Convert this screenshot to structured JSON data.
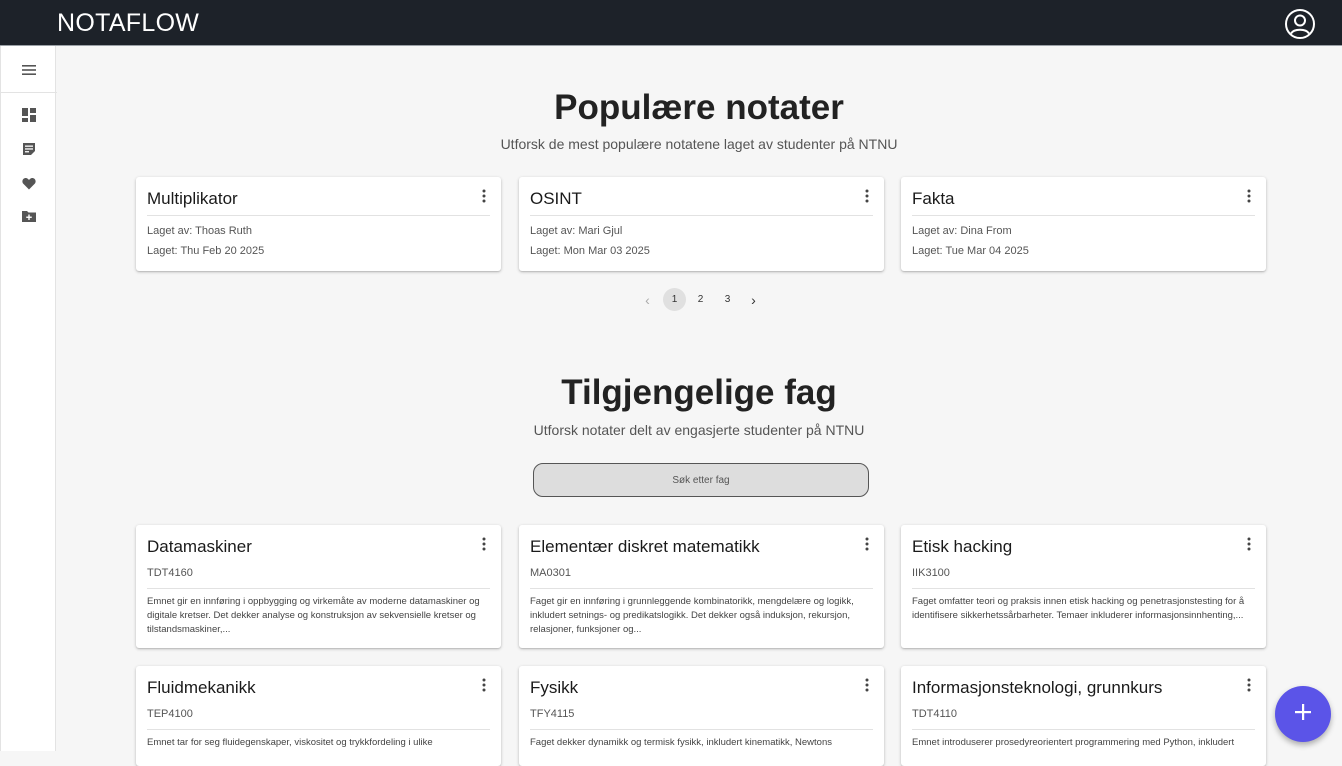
{
  "app": {
    "brand": "NOTAFLOW"
  },
  "sidebar": {
    "items": [
      {
        "icon": "menu-icon"
      },
      {
        "icon": "dashboard-icon"
      },
      {
        "icon": "notes-icon"
      },
      {
        "icon": "heart-icon"
      },
      {
        "icon": "add-folder-icon"
      }
    ]
  },
  "popular": {
    "title": "Populære notater",
    "subtitle": "Utforsk de mest populære notatene laget av studenter på NTNU",
    "cards": [
      {
        "title": "Multiplikator",
        "author": "Laget av: Thoas Ruth",
        "date": "Laget: Thu Feb 20 2025"
      },
      {
        "title": "OSINT",
        "author": "Laget av: Mari Gjul",
        "date": "Laget: Mon Mar 03 2025"
      },
      {
        "title": "Fakta",
        "author": "Laget av: Dina From",
        "date": "Laget: Tue Mar 04 2025"
      }
    ],
    "pagination": {
      "prev": "‹",
      "pages": [
        "1",
        "2",
        "3"
      ],
      "next": "›",
      "current": "1"
    }
  },
  "courses": {
    "title": "Tilgjengelige fag",
    "subtitle": "Utforsk notater delt av engasjerte studenter på NTNU",
    "search_label": "Søk etter fag",
    "cards": [
      {
        "title": "Datamaskiner",
        "code": "TDT4160",
        "desc": "Emnet gir en innføring i oppbygging og virkemåte av moderne datamaskiner og digitale kretser. Det dekker analyse og konstruksjon av sekvensielle kretser og tilstandsmaskiner,..."
      },
      {
        "title": "Elementær diskret matematikk",
        "code": "MA0301",
        "desc": "Faget gir en innføring i grunnleggende kombinatorikk, mengdelære og logikk, inkludert setnings- og predikatslogikk. Det dekker også induksjon, rekursjon, relasjoner, funksjoner og..."
      },
      {
        "title": "Etisk hacking",
        "code": "IIK3100",
        "desc": "Faget omfatter teori og praksis innen etisk hacking og penetrasjonstesting for å identifisere sikkerhetssårbarheter. Temaer inkluderer informasjonsinnhenting,..."
      },
      {
        "title": "Fluidmekanikk",
        "code": "TEP4100",
        "desc": "Emnet tar for seg fluidegenskaper, viskositet og trykkfordeling i ulike"
      },
      {
        "title": "Fysikk",
        "code": "TFY4115",
        "desc": "Faget dekker dynamikk og termisk fysikk, inkludert kinematikk, Newtons"
      },
      {
        "title": "Informasjonsteknologi, grunnkurs",
        "code": "TDT4110",
        "desc": "Emnet introduserer prosedyreorientert programmering med Python, inkludert"
      }
    ]
  },
  "fab": {
    "icon": "plus-icon"
  }
}
